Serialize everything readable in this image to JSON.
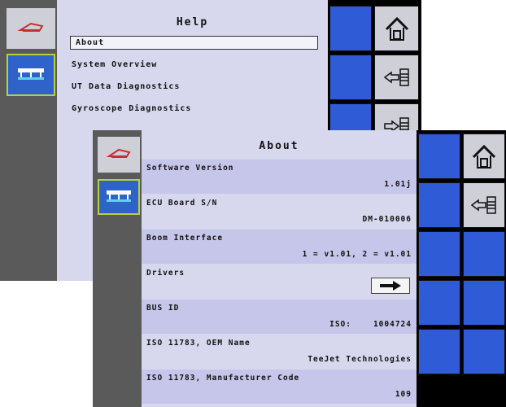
{
  "help_screen": {
    "title": "Help",
    "menu": [
      {
        "label": "About",
        "selected": true
      },
      {
        "label": "System Overview",
        "selected": false
      },
      {
        "label": "UT Data Diagnostics",
        "selected": false
      },
      {
        "label": "Gyroscope Diagnostics",
        "selected": false
      }
    ]
  },
  "about_screen": {
    "title": "About",
    "rows": [
      {
        "label": "Software Version",
        "value": "1.01j"
      },
      {
        "label": "ECU Board S/N",
        "value": "DM-010006"
      },
      {
        "label": "Boom Interface",
        "value": "1 = v1.01, 2 = v1.01"
      },
      {
        "label": "Drivers",
        "value": ""
      },
      {
        "label": "BUS ID",
        "mid": "ISO:",
        "value": "1004724"
      },
      {
        "label": "ISO 11783,   OEM Name",
        "value": "TeeJet Technologies"
      },
      {
        "label": "ISO 11783,   Manufacturer Code",
        "value": "109"
      }
    ]
  },
  "icons": {
    "tractor_icon": "tractor-icon",
    "boom_icon": "boom-icon",
    "home_icon": "home-icon",
    "back_icon": "back-list-icon",
    "forward_icon": "forward-list-icon",
    "arrow_icon": "right-arrow-icon"
  },
  "colors": {
    "content_bg": "#d7d7ee",
    "row_alt": "#c6c6ea",
    "active_tile": "#2f63c9",
    "active_border": "#b8cf3f",
    "button_blue": "#2f5bd6"
  }
}
